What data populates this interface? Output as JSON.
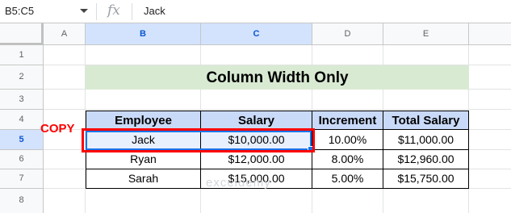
{
  "formula_bar": {
    "name_box": "B5:C5",
    "fx_symbol": "fx",
    "value": "Jack"
  },
  "columns": [
    "A",
    "B",
    "C",
    "D",
    "E"
  ],
  "rows": [
    "1",
    "2",
    "3",
    "4",
    "5",
    "6",
    "7",
    "8"
  ],
  "title": "Column Width Only",
  "copy_label": "COPY",
  "table": {
    "headers": [
      "Employee",
      "Salary",
      "Increment",
      "Total Salary"
    ],
    "rows": [
      [
        "Jack",
        "$10,000.00",
        "10.00%",
        "$11,000.00"
      ],
      [
        "Ryan",
        "$12,000.00",
        "8.00%",
        "$12,960.00"
      ],
      [
        "Sarah",
        "$15,000.00",
        "5.00%",
        "$15,750.00"
      ]
    ]
  },
  "watermark": "exceldemy",
  "colors": {
    "title_bg": "#d9ead3",
    "header_bg": "#c9daf8",
    "copy_red": "#ff0000",
    "selection_blue": "#1a73e8"
  }
}
